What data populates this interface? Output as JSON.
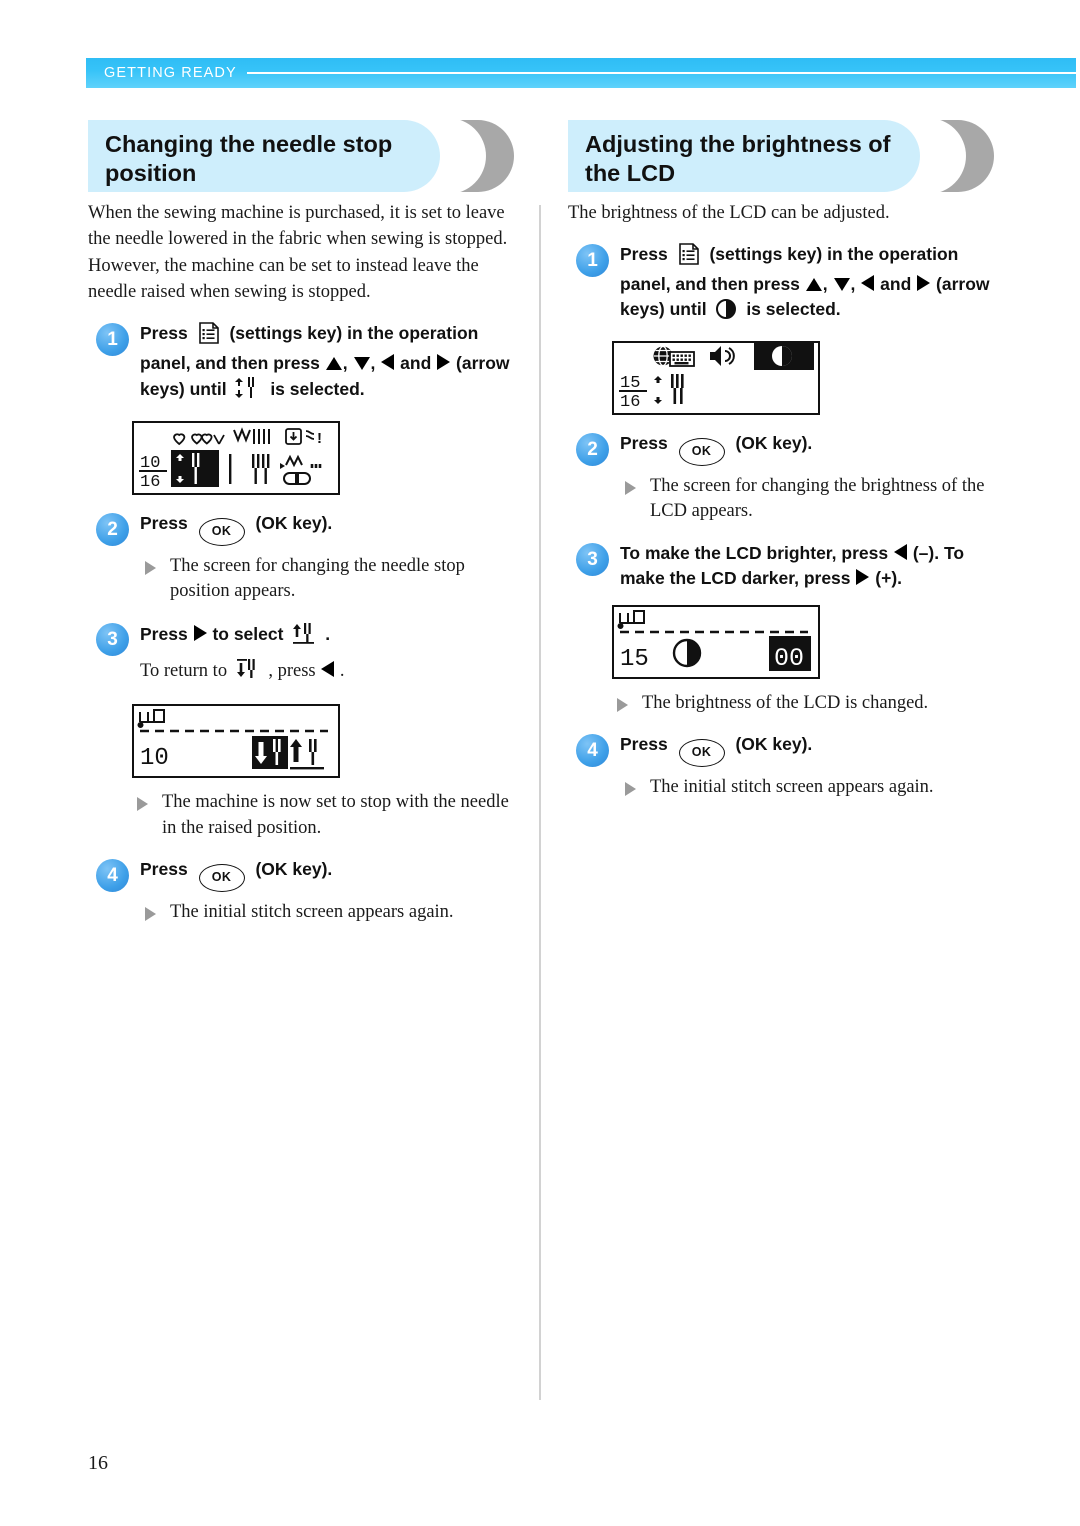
{
  "header": {
    "chapter": "GETTING READY"
  },
  "page": {
    "number": "16"
  },
  "left": {
    "heading": "Changing the needle stop position",
    "intro": "When the sewing machine is purchased, it is set to leave the needle lowered in the fabric when sewing is stopped. However, the machine can be set to instead leave the needle raised when sewing is stopped.",
    "steps": [
      {
        "num": "1",
        "text_before_key": "Press",
        "key_name": "settings-key",
        "text_after_key": "(settings key) in the operation panel, and then press",
        "arrows": "▲ , ▼ , ◀ and ▶",
        "text_tail": "(arrow keys) until",
        "target_icon": "needle-stop-position-icon",
        "text_end": "is selected."
      },
      {
        "num": "2",
        "text_before_key": "Press",
        "key_label": "OK",
        "text_after_key": "(OK key).",
        "result": "The screen for changing the needle stop position appears."
      },
      {
        "num": "3",
        "text_a": "Press",
        "text_b": "to select",
        "icon_select": "needle-up-icon",
        "text_c": ".",
        "sub_a": "To return to",
        "icon_return": "needle-down-icon",
        "sub_b": ", press",
        "sub_c": ".",
        "result": "The machine is now set to stop with the needle in the raised position."
      },
      {
        "num": "4",
        "text_before_key": "Press",
        "key_label": "OK",
        "text_after_key": "(OK key).",
        "result": "The initial stitch screen appears again."
      }
    ],
    "lcd_settings": {
      "fraction_top": "10",
      "fraction_bottom": "16",
      "row1_icons": [
        "heart-stitch-icon",
        "double-heart-stitch-icon",
        "zigzag-stitch-icon",
        "straight-stitch-icon",
        "presser-foot-icon",
        "speed-icon"
      ],
      "row2_icons": [
        "needle-stop-position-icon",
        "needle-position-icon",
        "twin-needle-icon",
        "thread-cutter-icon"
      ],
      "selected": "needle-stop-position-icon"
    },
    "lcd_needle": {
      "corner_icon": "machine-icon",
      "value": "10",
      "option_down": "needle-down-icon",
      "option_up": "needle-up-icon",
      "selected_option": "needle-down-icon"
    }
  },
  "right": {
    "heading": "Adjusting the brightness of the LCD",
    "intro": "The brightness of the LCD can be adjusted.",
    "steps": [
      {
        "num": "1",
        "text_before_key": "Press",
        "key_name": "settings-key",
        "text_after_key": "(settings key) in the operation panel, and then press",
        "arrows": "▲ , ▼ , ◀ and ▶",
        "text_tail": "(arrow keys) until",
        "target_icon": "brightness-icon",
        "text_end": "is selected."
      },
      {
        "num": "2",
        "text_before_key": "Press",
        "key_label": "OK",
        "text_after_key": "(OK key).",
        "result": "The screen for changing the brightness of the LCD appears."
      },
      {
        "num": "3",
        "text_a": "To make the LCD brighter, press",
        "text_b": "(–). To make the LCD darker, press",
        "text_c": "(+).",
        "result": "The brightness of the LCD is changed."
      },
      {
        "num": "4",
        "text_before_key": "Press",
        "key_label": "OK",
        "text_after_key": "(OK key).",
        "result": "The initial stitch screen appears again."
      }
    ],
    "lcd_settings": {
      "fraction_top": "15",
      "fraction_bottom": "16",
      "row1_icons": [
        "language-icon",
        "sound-icon",
        "brightness-icon"
      ],
      "row2_icons": [
        "needle-position-icon"
      ],
      "selected": "brightness-icon"
    },
    "lcd_brightness": {
      "corner_icon": "machine-icon",
      "value": "15",
      "brightness_icon": "brightness-icon",
      "level": "00",
      "level_highlighted": true
    }
  },
  "colors": {
    "header_band": "#36c3f8",
    "heading_bar": "#ceeefc",
    "heading_crescent": "#a8a8a8",
    "step_number": "#3d9fe8",
    "divider": "#d2d2d2",
    "triangle_marker": "#9a9a9a"
  }
}
